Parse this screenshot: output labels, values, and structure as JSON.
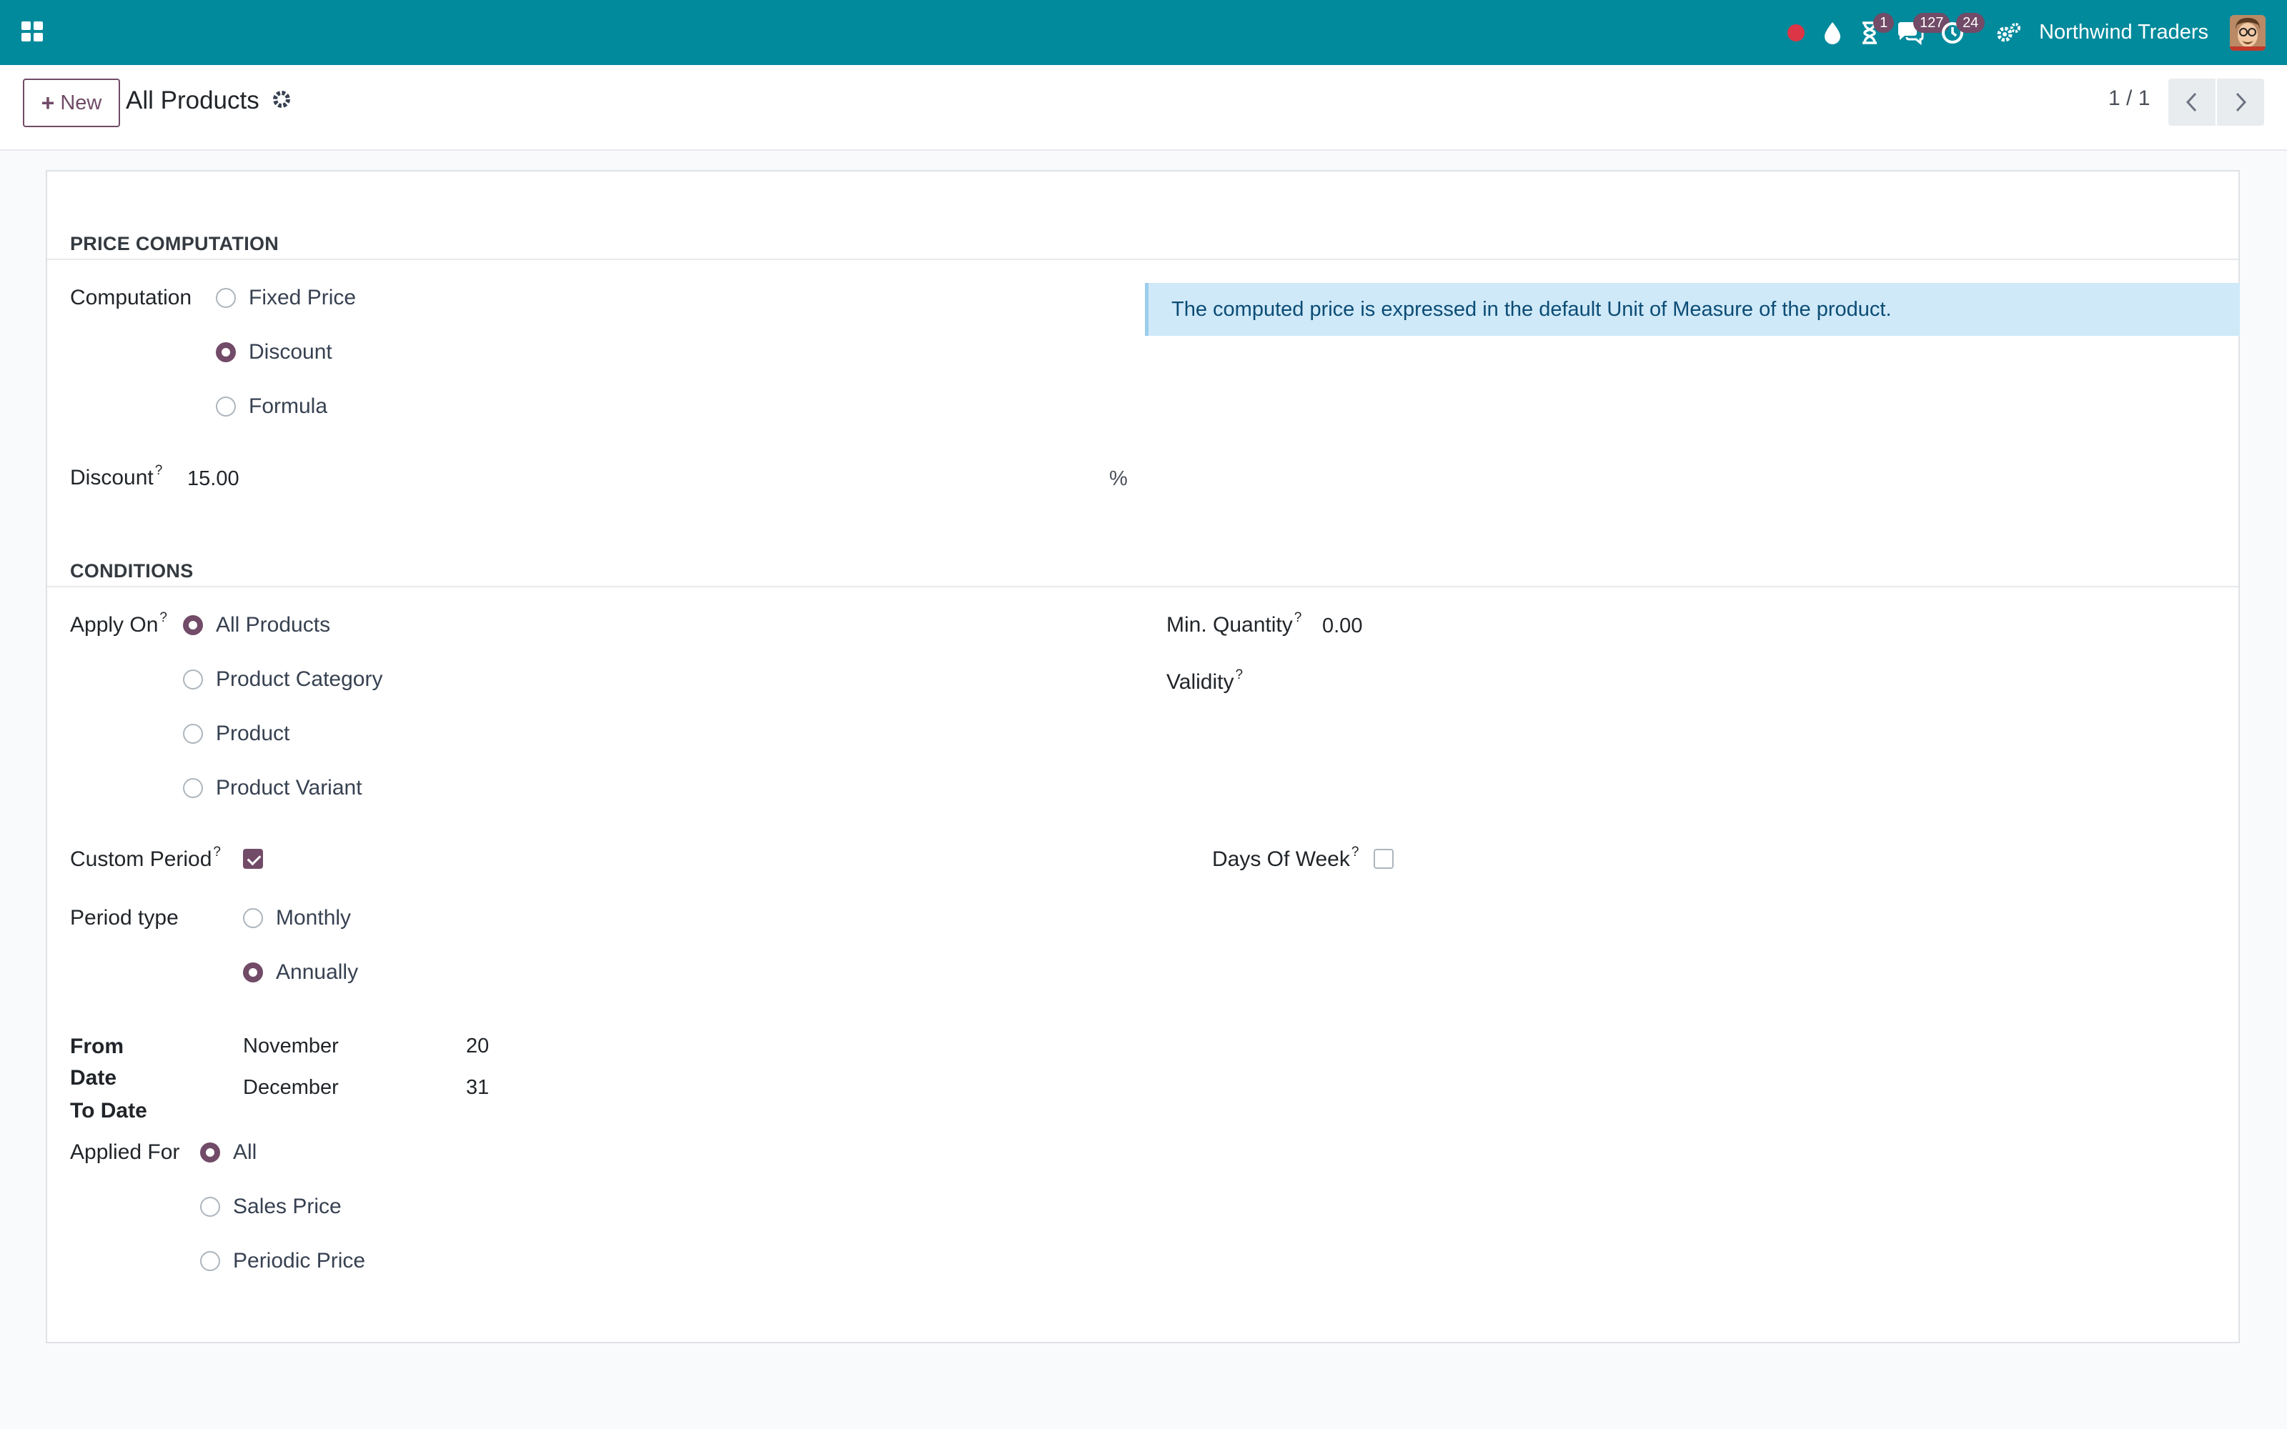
{
  "navbar": {
    "apps_icon": "apps-grid-icon",
    "indicators": [
      {
        "icon": "record-dot-icon",
        "color": "#dc3545"
      },
      {
        "icon": "droplet-icon"
      },
      {
        "icon": "hourglass-icon",
        "badge": "1"
      },
      {
        "icon": "chat-bubbles-icon",
        "badge": "127"
      },
      {
        "icon": "clock-activity-icon",
        "badge": "24"
      },
      {
        "icon": "settings-gears-icon"
      }
    ],
    "company": "Northwind Traders",
    "avatar_icon": "user-avatar-icon"
  },
  "control_panel": {
    "new_label": "New",
    "breadcrumb": "All Products",
    "pager": "1 / 1"
  },
  "price_computation": {
    "title": "PRICE COMPUTATION",
    "computation_label": "Computation",
    "options": [
      "Fixed Price",
      "Discount",
      "Formula"
    ],
    "selected": "Discount",
    "info": "The computed price is expressed in the default Unit of Measure of the product.",
    "discount_label": "Discount",
    "discount_value": "15.00",
    "discount_unit": "%"
  },
  "conditions": {
    "title": "CONDITIONS",
    "apply_on_label": "Apply On",
    "apply_on_options": [
      "All Products",
      "Product Category",
      "Product",
      "Product Variant"
    ],
    "apply_on_selected": "All Products",
    "min_quantity_label": "Min. Quantity",
    "min_quantity_value": "0.00",
    "validity_label": "Validity",
    "custom_period_label": "Custom Period",
    "custom_period_checked": true,
    "days_of_week_label": "Days Of Week",
    "days_of_week_checked": false,
    "period_type_label": "Period type",
    "period_type_options": [
      "Monthly",
      "Annually"
    ],
    "period_type_selected": "Annually",
    "from_date_label_1": "From",
    "from_date_label_2": "Date",
    "to_date_label": "To Date",
    "from_month": "November",
    "from_day": "20",
    "to_month": "December",
    "to_day": "31",
    "applied_for_label": "Applied For",
    "applied_for_options": [
      "All",
      "Sales Price",
      "Periodic Price"
    ],
    "applied_for_selected": "All"
  },
  "help_mark": "?",
  "colors": {
    "navbar": "#018a9c",
    "accent": "#714b67",
    "info_bg": "#cfe9f9",
    "info_text": "#0c4c74"
  }
}
